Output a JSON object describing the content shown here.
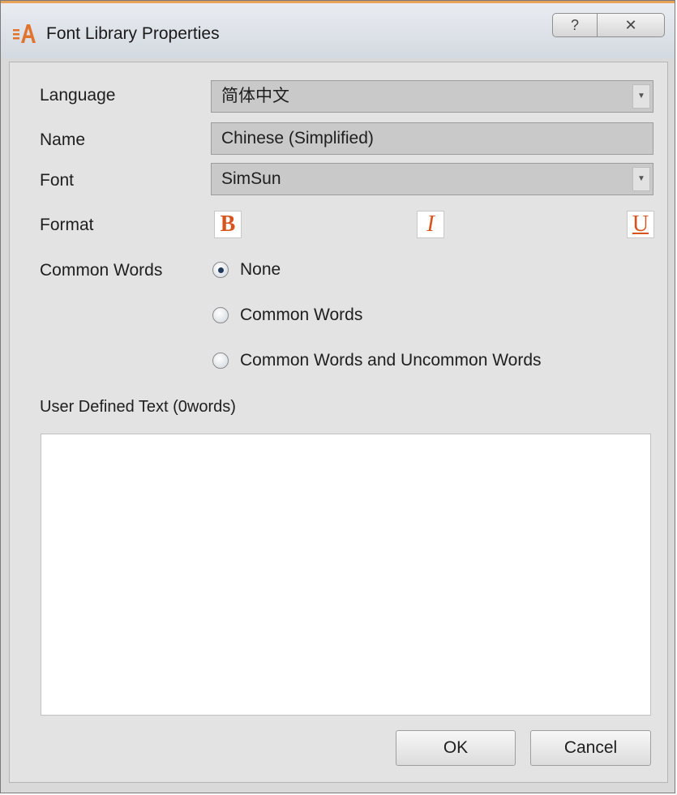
{
  "window": {
    "title": "Font Library Properties",
    "help_glyph": "?",
    "close_glyph": "✕",
    "app_icon": "font-library-icon"
  },
  "form": {
    "language": {
      "label": "Language",
      "value": "简体中文"
    },
    "name": {
      "label": "Name",
      "value": "Chinese (Simplified)"
    },
    "font": {
      "label": "Font",
      "value": "SimSun"
    },
    "format": {
      "label": "Format",
      "bold": "B",
      "italic": "I",
      "underline": "U"
    },
    "common_words": {
      "label": "Common Words",
      "options": [
        "None",
        "Common Words",
        "Common Words and Uncommon Words"
      ],
      "selected": "None"
    },
    "user_text": {
      "label": "User Defined Text (0words)",
      "value": ""
    }
  },
  "buttons": {
    "ok": "OK",
    "cancel": "Cancel"
  },
  "colors": {
    "accent": "#d9531e",
    "dialog_bg": "#e3e3e3",
    "field_bg": "#c9c9c9"
  }
}
